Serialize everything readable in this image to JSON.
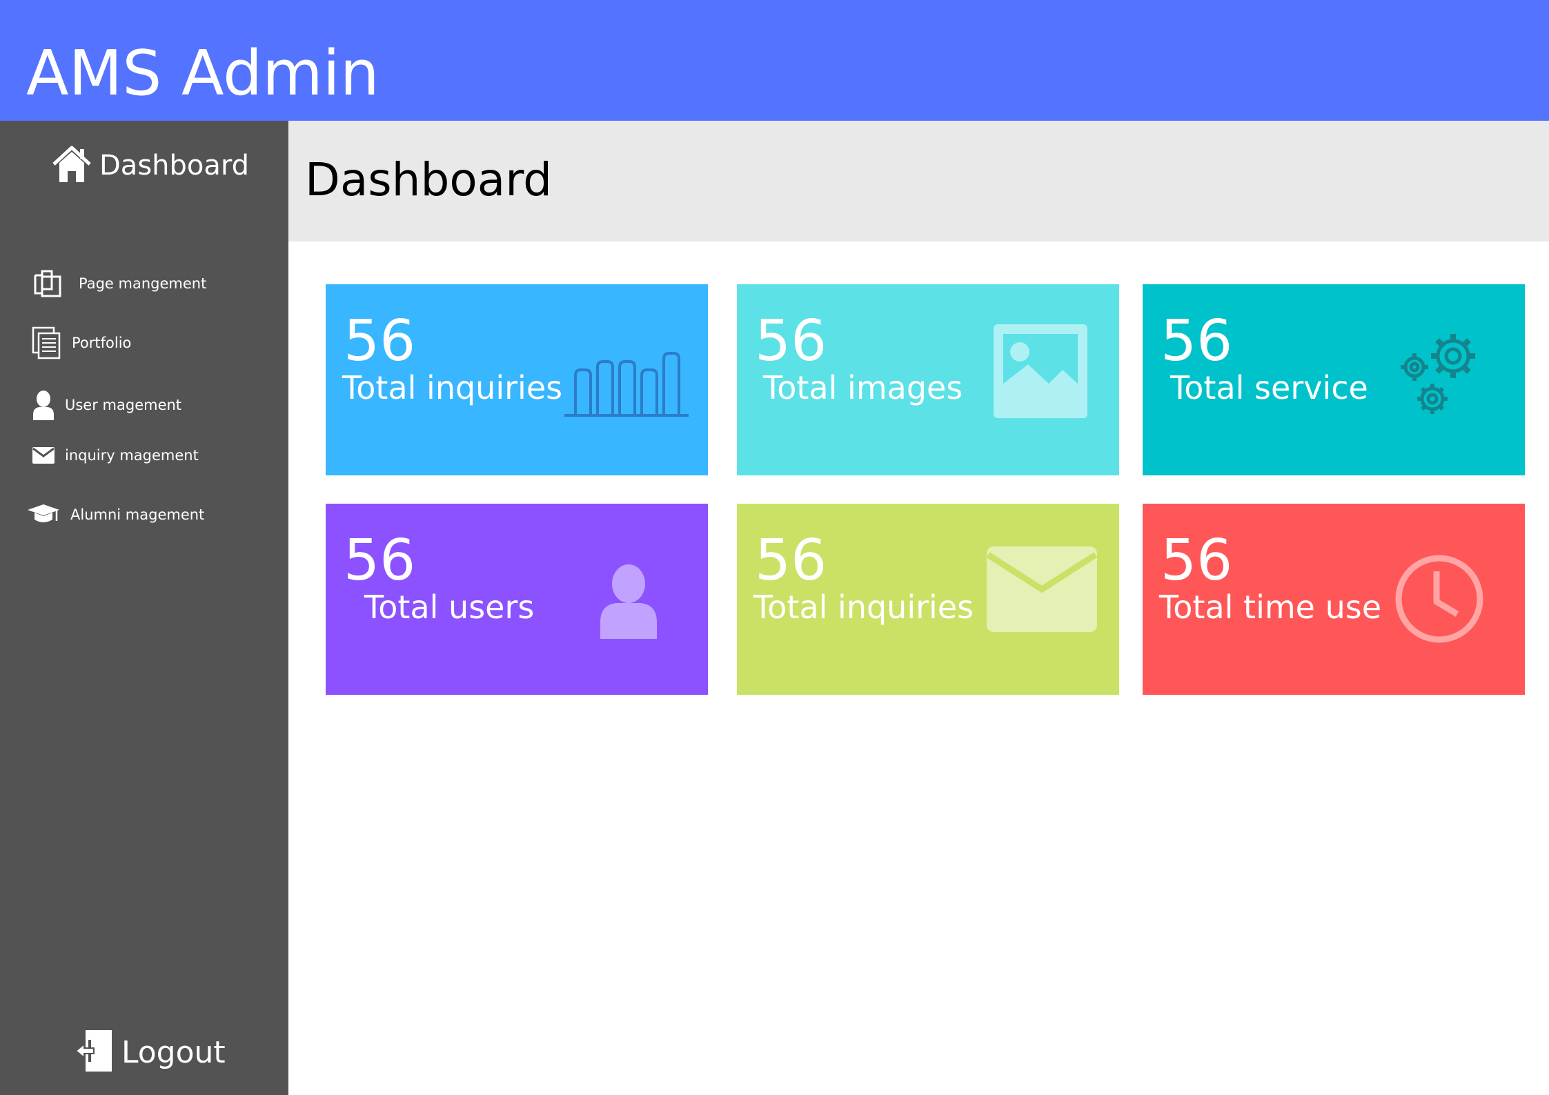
{
  "app": {
    "title": "AMS Admin"
  },
  "sidebar": {
    "dashboard_label": "Dashboard",
    "items": [
      {
        "label": "Page mangement",
        "icon": "pages-icon"
      },
      {
        "label": "Portfolio",
        "icon": "documents-icon"
      },
      {
        "label": "User magement",
        "icon": "user-icon"
      },
      {
        "label": "inquiry magement",
        "icon": "envelope-icon"
      },
      {
        "label": "Alumni magement",
        "icon": "graduation-cap-icon"
      }
    ],
    "logout_label": "Logout"
  },
  "main": {
    "title": "Dashboard",
    "cards": [
      {
        "value": "56",
        "label": "Total inquiries",
        "icon": "bar-chart-icon",
        "color": "#38b6ff"
      },
      {
        "value": "56",
        "label": "Total images",
        "icon": "image-icon",
        "color": "#5ce1e6"
      },
      {
        "value": "56",
        "label": "Total service",
        "icon": "gears-icon",
        "color": "#00c2cb"
      },
      {
        "value": "56",
        "label": "Total users",
        "icon": "user-icon",
        "color": "#8c52ff"
      },
      {
        "value": "56",
        "label": "Total inquiries",
        "icon": "envelope-icon",
        "color": "#c9e265"
      },
      {
        "value": "56",
        "label": "Total time use",
        "icon": "clock-icon",
        "color": "#ff5757"
      }
    ]
  },
  "colors": {
    "topbar": "#5473ff",
    "sidebar": "#535353",
    "header_band": "#e9e9e9"
  }
}
